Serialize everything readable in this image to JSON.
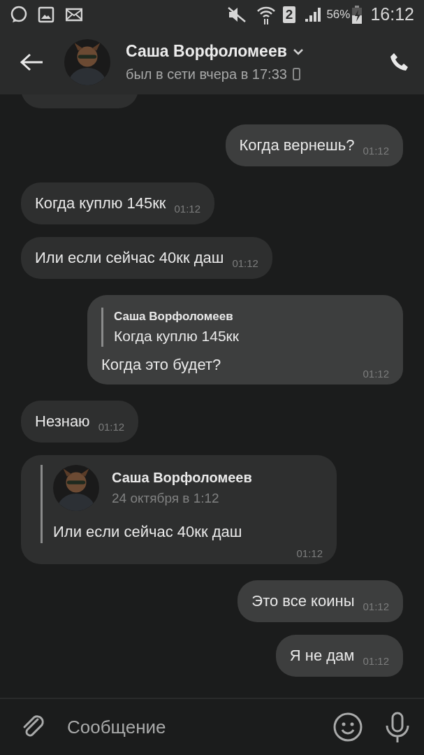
{
  "status_bar": {
    "sim": "2",
    "battery": "56%",
    "time": "16:12"
  },
  "header": {
    "name": "Саша Ворфоломеев",
    "status": "был в сети вчера в 17:33"
  },
  "messages": [
    {
      "kind": "partial",
      "outgoing": false
    },
    {
      "kind": "text",
      "outgoing": true,
      "text": "Когда вернешь?",
      "time": "01:12"
    },
    {
      "kind": "text",
      "outgoing": false,
      "text": "Когда куплю 145кк",
      "time": "01:12"
    },
    {
      "kind": "text",
      "outgoing": false,
      "text": "Или если сейчас 40кк даш",
      "time": "01:12"
    },
    {
      "kind": "reply",
      "outgoing": true,
      "quote_name": "Саша Ворфоломеев",
      "quote_text": "Когда куплю 145кк",
      "text": "Когда это будет?",
      "time": "01:12"
    },
    {
      "kind": "text",
      "outgoing": false,
      "text": "Незнаю",
      "time": "01:12"
    },
    {
      "kind": "forward",
      "outgoing": false,
      "fwd_name": "Саша Ворфоломеев",
      "fwd_date": "24 октября в 1:12",
      "text": "Или если сейчас 40кк даш",
      "time": "01:12"
    },
    {
      "kind": "text",
      "outgoing": true,
      "text": "Это все коины",
      "time": "01:12"
    },
    {
      "kind": "text",
      "outgoing": true,
      "text": "Я не дам",
      "time": "01:12"
    }
  ],
  "composer": {
    "placeholder": "Сообщение"
  }
}
